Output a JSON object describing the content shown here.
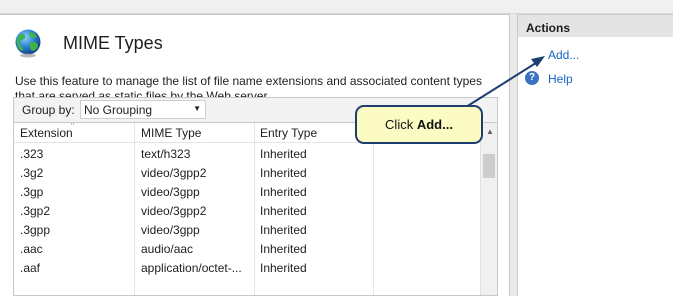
{
  "feature": {
    "title": "MIME Types",
    "icon": "globe-icon",
    "description": "Use this feature to manage the list of file name extensions and associated content types that are served as static files by the Web server."
  },
  "grouping": {
    "label": "Group by:",
    "value": "No Grouping"
  },
  "table": {
    "columns": [
      "Extension",
      "MIME Type",
      "Entry Type"
    ],
    "sorted_column": "Extension",
    "rows": [
      [
        ".323",
        "text/h323",
        "Inherited"
      ],
      [
        ".3g2",
        "video/3gpp2",
        "Inherited"
      ],
      [
        ".3gp",
        "video/3gpp",
        "Inherited"
      ],
      [
        ".3gp2",
        "video/3gpp2",
        "Inherited"
      ],
      [
        ".3gpp",
        "video/3gpp",
        "Inherited"
      ],
      [
        ".aac",
        "audio/aac",
        "Inherited"
      ],
      [
        ".aaf",
        "application/octet-...",
        "Inherited"
      ]
    ]
  },
  "actions": {
    "header": "Actions",
    "items": [
      {
        "label": "Add...",
        "icon": ""
      },
      {
        "label": "Help",
        "icon": "help-icon"
      }
    ]
  },
  "callout": {
    "prefix": "Click ",
    "emphasis": "Add..."
  },
  "colors": {
    "link": "#1565c0",
    "callout_fill": "#fbfbc3",
    "callout_border": "#1e3e72"
  }
}
